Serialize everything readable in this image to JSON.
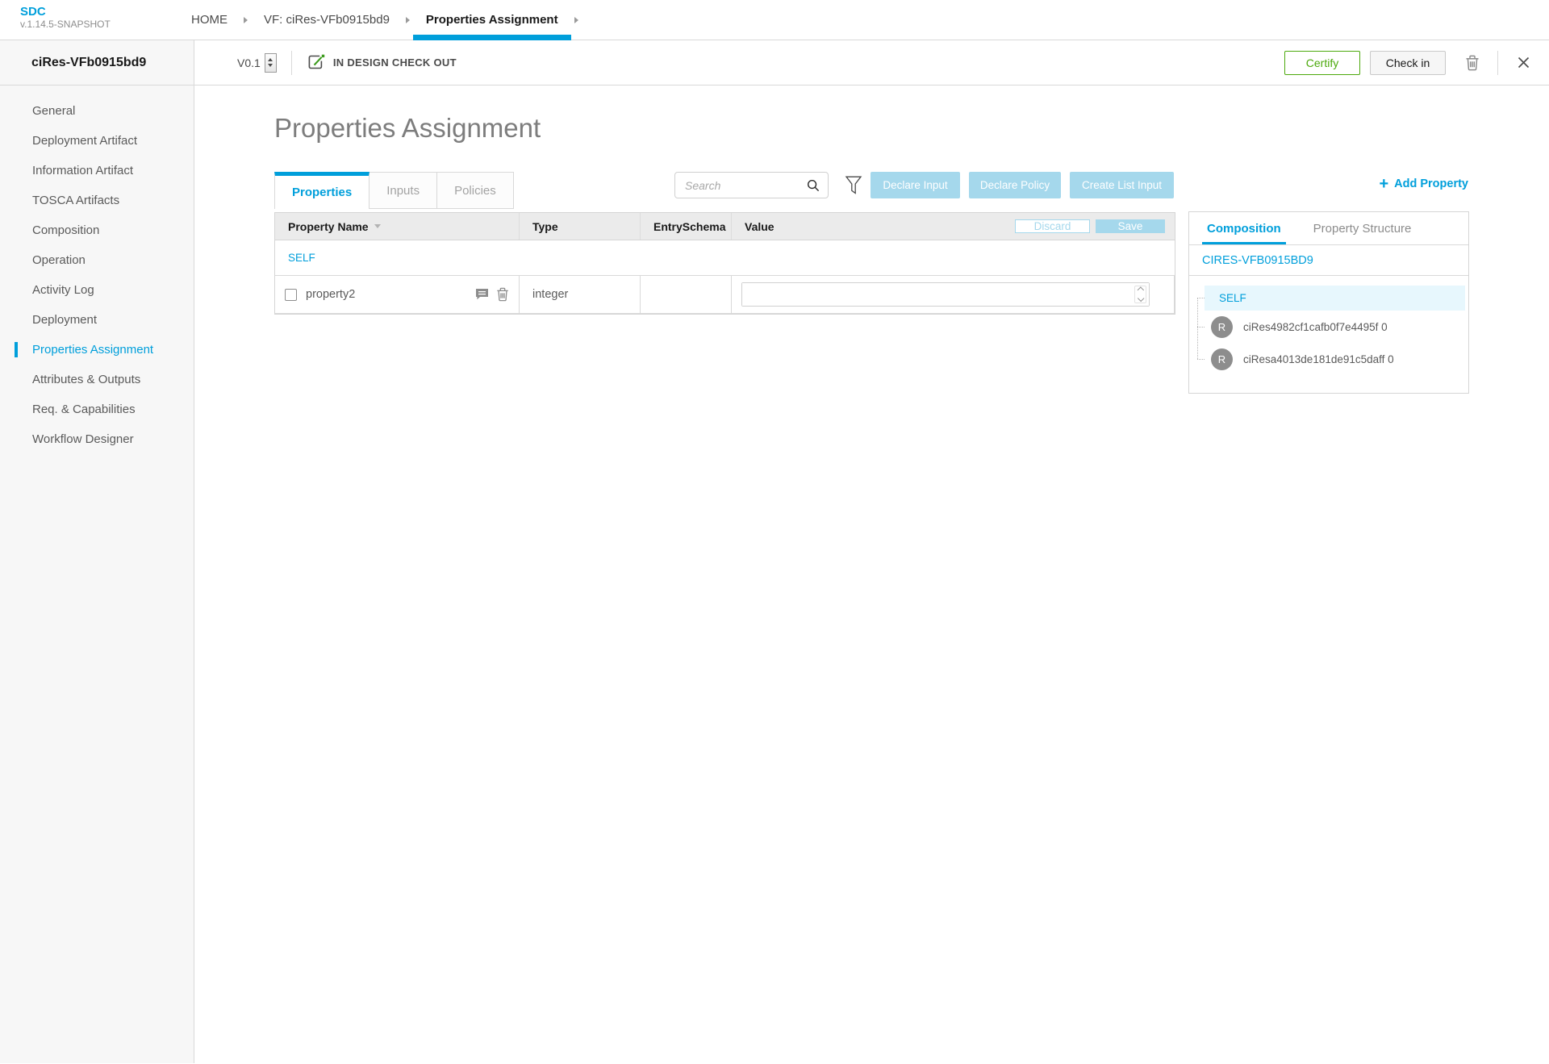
{
  "app": {
    "name": "SDC",
    "version": "v.1.14.5-SNAPSHOT"
  },
  "breadcrumbs": {
    "home": "HOME",
    "vf": "VF: ciRes-VFb0915bd9",
    "current": "Properties Assignment"
  },
  "workspace": {
    "entity_name": "ciRes-VFb0915bd9",
    "version": "V0.1",
    "lifecycle_status": "IN DESIGN CHECK OUT",
    "certify_label": "Certify",
    "check_in_label": "Check in"
  },
  "sidebar": {
    "items": [
      "General",
      "Deployment Artifact",
      "Information Artifact",
      "TOSCA Artifacts",
      "Composition",
      "Operation",
      "Activity Log",
      "Deployment",
      "Properties Assignment",
      "Attributes & Outputs",
      "Req. & Capabilities",
      "Workflow Designer"
    ],
    "active_item": "Properties Assignment"
  },
  "main": {
    "title": "Properties Assignment",
    "tabs": [
      "Properties",
      "Inputs",
      "Policies"
    ],
    "active_tab": "Properties",
    "search_placeholder": "Search",
    "buttons": {
      "declare_input": "Declare Input",
      "declare_policy": "Declare Policy",
      "create_list_input": "Create List Input"
    },
    "add_property": {
      "plus": "+",
      "label": "Add Property"
    },
    "table": {
      "columns": [
        "Property Name",
        "Type",
        "EntrySchema",
        "Value"
      ],
      "discard_label": "Discard",
      "save_label": "Save",
      "group_label": "SELF",
      "rows": [
        {
          "name": "property2",
          "type": "integer",
          "entry_schema": "",
          "value": ""
        }
      ]
    }
  },
  "right_panel": {
    "tabs": [
      "Composition",
      "Property Structure"
    ],
    "active_tab": "Composition",
    "root_label": "CIRES-VFB0915BD9",
    "tree": {
      "self_label": "SELF",
      "items": [
        {
          "avatar_letter": "R",
          "label": "ciRes4982cf1cafb0f7e4495f 0"
        },
        {
          "avatar_letter": "R",
          "label": "ciResa4013de181de91c5daff 0"
        }
      ]
    }
  },
  "colors": {
    "accent_blue": "#009fdb",
    "light_blue_button": "#a5d8ec",
    "certify_green": "#4ca90c",
    "selected_row_bg": "#e7f7fd",
    "avatar_gray": "#8d8d8d"
  }
}
